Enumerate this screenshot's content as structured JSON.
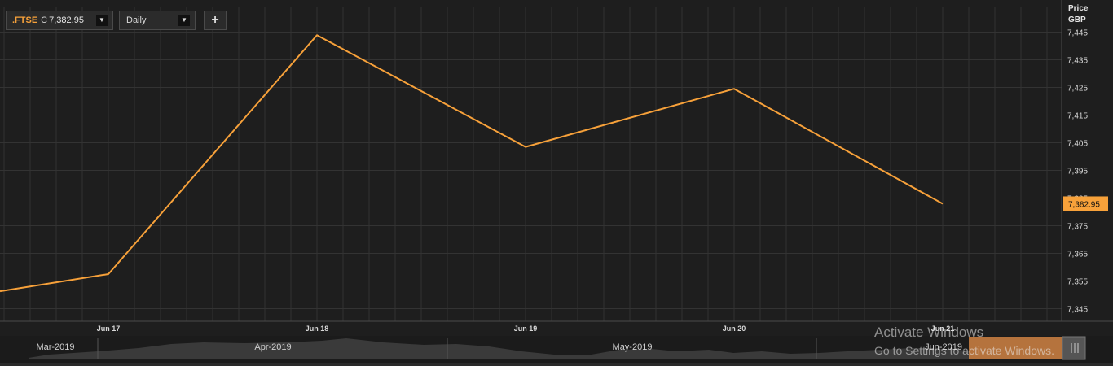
{
  "instrument": {
    "ric": ".FTSE",
    "close_prefix": "C",
    "last_value": "7,382.95"
  },
  "toolbar": {
    "period": "Daily",
    "add_label": "+"
  },
  "price_axis": {
    "header1": "Price",
    "header2": "GBP",
    "last_badge": "7,382.95"
  },
  "colors": {
    "series": "#f7a13a",
    "background": "#1e1e1e",
    "grid": "#3a3a3a"
  },
  "chart_data": {
    "type": "line",
    "series": [
      {
        "x": [
          "Jun 17",
          "Jun 18",
          "Jun 19",
          "Jun 20",
          "Jun 21"
        ],
        "values": [
          7357.5,
          7443.9,
          7403.5,
          7424.5,
          7382.95
        ]
      }
    ],
    "series_start_value": 7351.3,
    "x_tick_labels": [
      "Jun 17",
      "Jun 18",
      "Jun 19",
      "Jun 20",
      "Jun 21"
    ],
    "y_tick_labels": [
      "7,445",
      "7,435",
      "7,425",
      "7,415",
      "7,405",
      "7,395",
      "7,385",
      "7,375",
      "7,365",
      "7,355",
      "7,345"
    ],
    "y_ticks": [
      7445,
      7435,
      7425,
      7415,
      7405,
      7395,
      7385,
      7375,
      7365,
      7355,
      7345
    ],
    "ylim": [
      7340,
      7450
    ],
    "grid": true
  },
  "navigator": {
    "labels": [
      "Mar-2019",
      "Apr-2019",
      "May-2019",
      "Jun-2019"
    ]
  },
  "watermark": {
    "line1": "Activate Windows",
    "line2": "Go to Settings to activate Windows."
  }
}
